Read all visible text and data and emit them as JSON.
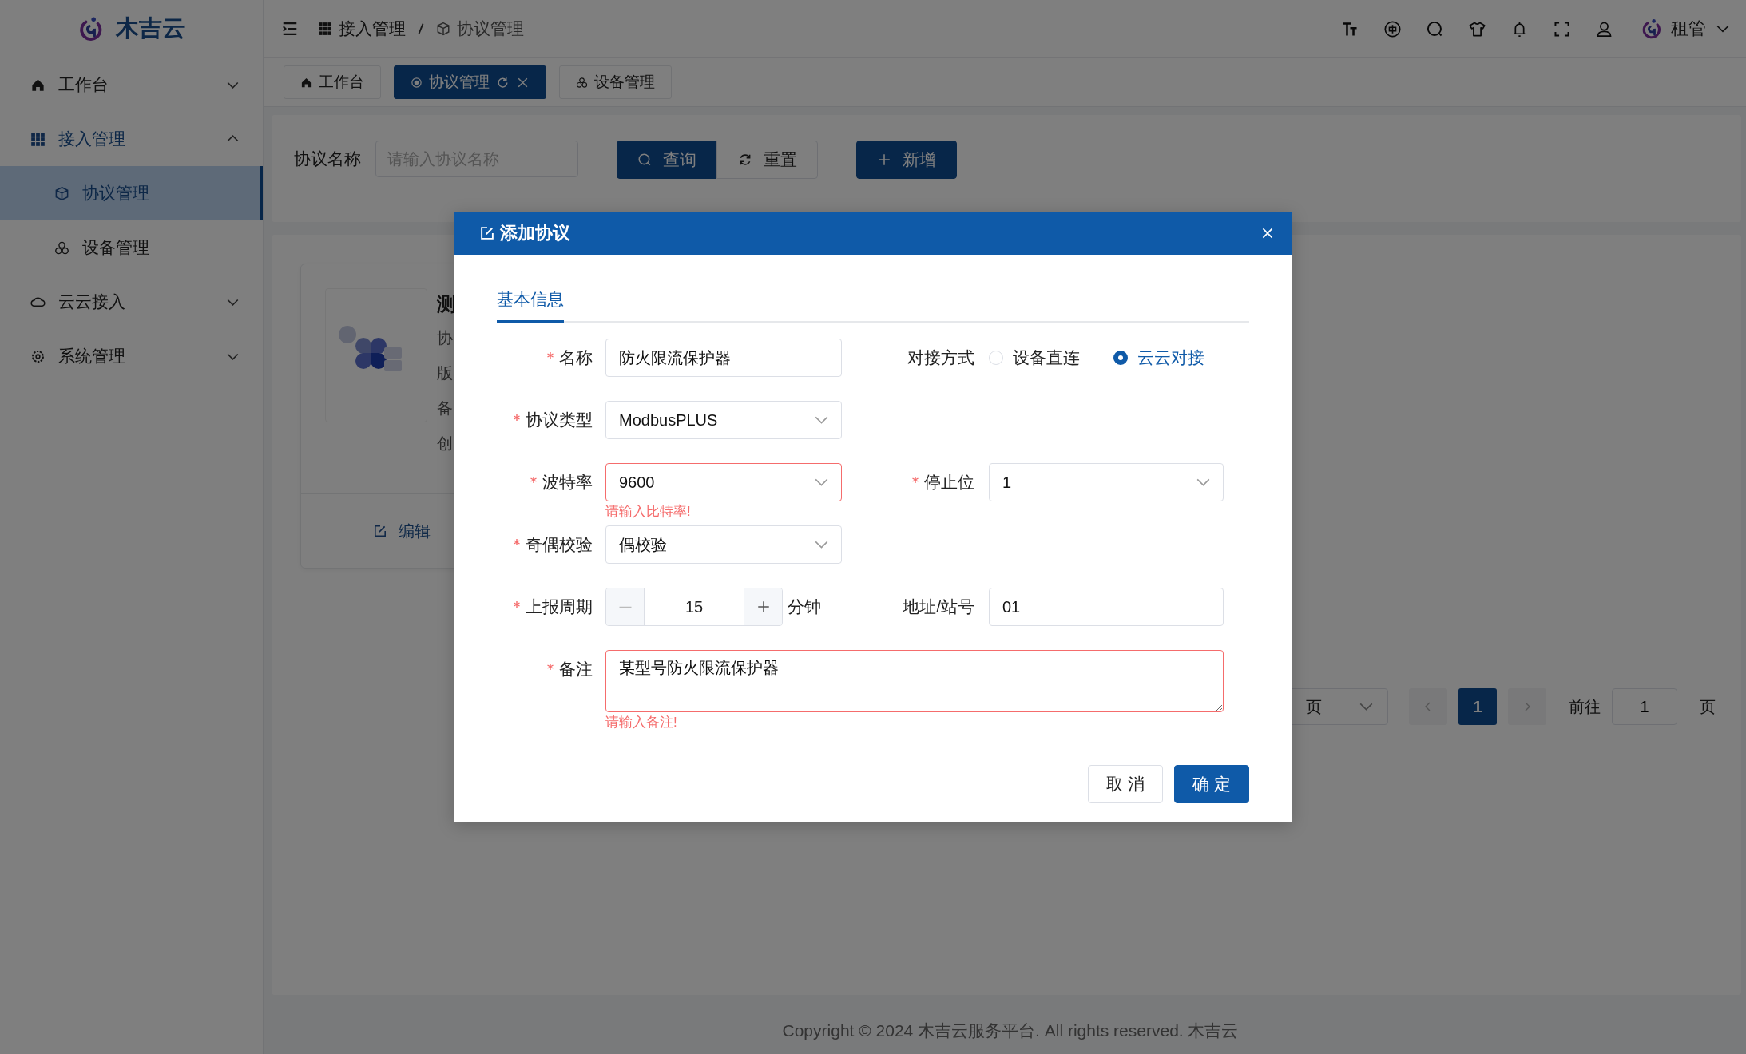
{
  "sidebar": {
    "logo": "木吉云",
    "items": [
      {
        "label": "工作台",
        "expanded": false
      },
      {
        "label": "接入管理",
        "expanded": true,
        "children": [
          {
            "label": "协议管理",
            "selected": true
          },
          {
            "label": "设备管理",
            "selected": false
          }
        ]
      },
      {
        "label": "云云接入",
        "expanded": false
      },
      {
        "label": "系统管理",
        "expanded": false
      }
    ]
  },
  "header": {
    "breadcrumb": [
      "接入管理",
      "协议管理"
    ],
    "user": "租管"
  },
  "tabs": [
    {
      "label": "工作台",
      "selected": false,
      "closable": false
    },
    {
      "label": "协议管理",
      "selected": true,
      "closable": true
    },
    {
      "label": "设备管理",
      "selected": false,
      "closable": false
    }
  ],
  "search": {
    "label": "协议名称",
    "placeholder": "请输入协议名称",
    "buttons": [
      {
        "label": "查询",
        "kind": "search"
      },
      {
        "label": "重置",
        "kind": "reset"
      },
      {
        "label": "新增",
        "kind": "add"
      }
    ]
  },
  "card": {
    "title": "测",
    "lines": [
      "协",
      "版",
      "备",
      "创"
    ],
    "action": "编辑"
  },
  "pagination": {
    "size_select": "页",
    "pages": [
      {
        "label": "1",
        "selected": true
      }
    ],
    "goto_label": "前往",
    "goto_value": "1",
    "goto_unit": "页"
  },
  "footer": "Copyright © 2024 木吉云服务平台. All rights reserved. 木吉云",
  "dialog": {
    "title": "添加协议",
    "tabs": [
      {
        "label": "基本信息",
        "selected": true
      }
    ],
    "rows": [
      [
        {
          "kind": "text",
          "label": "名称",
          "required": true,
          "value": "防火限流保护器"
        },
        {
          "kind": "radio",
          "label": "对接方式",
          "required": false,
          "options": [
            {
              "label": "设备直连",
              "selected": false
            },
            {
              "label": "云云对接",
              "selected": true
            }
          ]
        }
      ],
      [
        {
          "kind": "select",
          "label": "协议类型",
          "required": true,
          "value": "ModbusPLUS"
        }
      ],
      [
        {
          "kind": "select",
          "label": "波特率",
          "required": true,
          "value": "9600",
          "error": "请输入比特率!"
        },
        {
          "kind": "select",
          "label": "停止位",
          "required": true,
          "value": "1"
        }
      ],
      [
        {
          "kind": "select",
          "label": "奇偶校验",
          "required": true,
          "value": "偶校验"
        }
      ],
      [
        {
          "kind": "stepper",
          "label": "上报周期",
          "required": true,
          "value": "15",
          "unit": "分钟"
        },
        {
          "kind": "text",
          "label": "地址/站号",
          "required": false,
          "value": "01"
        }
      ],
      [
        {
          "kind": "textarea",
          "label": "备注",
          "required": true,
          "value": "某型号防火限流保护器",
          "error": "请输入备注!"
        }
      ]
    ],
    "buttons": [
      {
        "label": "取 消",
        "kind": "default"
      },
      {
        "label": "确 定",
        "kind": "primary"
      }
    ]
  }
}
